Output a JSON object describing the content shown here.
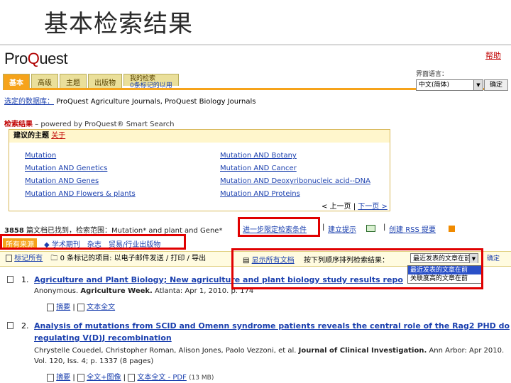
{
  "slide_title": "基本检索结果",
  "logo": {
    "pre": "Pro",
    "q": "Q",
    "post": "uest"
  },
  "help": "帮助",
  "tabs": [
    {
      "label": "基本",
      "active": true
    },
    {
      "label": "高级"
    },
    {
      "label": "主题"
    },
    {
      "label": "出版物"
    }
  ],
  "my_search": {
    "label": "我的检索",
    "sub": "0条标记的以用"
  },
  "language": {
    "label": "界面语言：",
    "value": "中文(简体)",
    "button": "确定"
  },
  "databases": {
    "label": "选定的数据库：",
    "value": "ProQuest Agriculture Journals, ProQuest Biology Journals"
  },
  "search_results": {
    "label": "检索结果",
    "powered": " – powered by ProQuest® Smart Search"
  },
  "suggested": {
    "head": "建议的主题",
    "about": "关于",
    "left": [
      "Mutation",
      "Mutation AND Genetics",
      "Mutation AND Genes",
      "Mutation AND Flowers & plants"
    ],
    "right": [
      "Mutation AND Botany",
      "Mutation AND Cancer",
      "Mutation AND Deoxyribonucleic acid--DNA",
      "Mutation AND Proteins"
    ],
    "prev": "< 上一页",
    "next": "下一页 >"
  },
  "count_line": {
    "count": "3858",
    "text": " 篇文档已找到，检索范围：Mutation* and plant and Gene*"
  },
  "actions": {
    "narrow": "进一步限定检索条件",
    "alert": "建立提示",
    "create": "创建",
    "rss": "RSS 提要"
  },
  "source_tabs": [
    "所有来源",
    "学术期刊",
    "杂志",
    "贸易/行业出版物"
  ],
  "toolbar": {
    "mark_all": "标记所有",
    "marked": "0 条标记的项目: 以电子邮件发送 / 打印 / 导出",
    "show_all": "显示所有文档",
    "sort_label": "按下列顺序排列检索结果：",
    "sort_value": "最近发表的文章在前",
    "go": "确定"
  },
  "sort_options": [
    "最近发表的文章在前",
    "关联度高的文章在前"
  ],
  "results": [
    {
      "num": "1.",
      "title": "Agriculture and Plant Biology; New agriculture and plant biology study results reported from Univ",
      "meta_plain": "Anonymous. ",
      "meta_bold": "Agriculture Week.",
      "meta_tail": " Atlanta: Apr 1, 2010. p. 174",
      "links": [
        "摘要",
        "文本全文"
      ]
    },
    {
      "num": "2.",
      "title_line1": "Analysis of mutations from SCID and Omenn syndrome patients reveals the central role of the Rag2 PHD domain in",
      "title_line2": "regulating V(D)J recombination",
      "meta_plain": "Chrystelle Couedel, Christopher Roman, Alison Jones, Paolo Vezzoni, et al. ",
      "meta_bold": "Journal of Clinical Investigation.",
      "meta_tail": " Ann Arbor: Apr 2010.",
      "meta_line2": "Vol. 120, Iss. 4; p. 1337 (8 pages)",
      "links": [
        "摘要",
        "全文+图像",
        "文本全文 - PDF"
      ],
      "pdf_size": "(13 MB)"
    }
  ]
}
